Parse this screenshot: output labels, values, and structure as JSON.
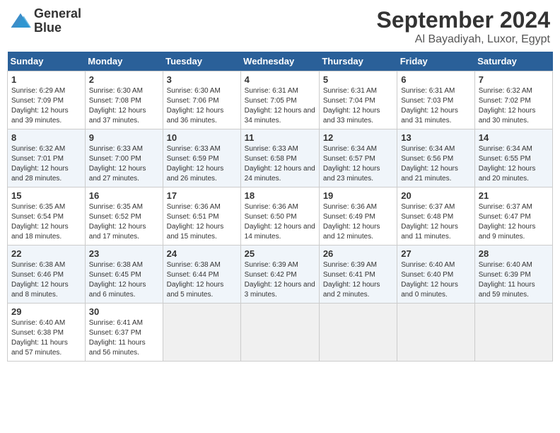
{
  "header": {
    "logo_line1": "General",
    "logo_line2": "Blue",
    "month": "September 2024",
    "location": "Al Bayadiyah, Luxor, Egypt"
  },
  "days_of_week": [
    "Sunday",
    "Monday",
    "Tuesday",
    "Wednesday",
    "Thursday",
    "Friday",
    "Saturday"
  ],
  "weeks": [
    [
      {
        "day": "1",
        "sunrise": "6:29 AM",
        "sunset": "7:09 PM",
        "daylight": "12 hours and 39 minutes."
      },
      {
        "day": "2",
        "sunrise": "6:30 AM",
        "sunset": "7:08 PM",
        "daylight": "12 hours and 37 minutes."
      },
      {
        "day": "3",
        "sunrise": "6:30 AM",
        "sunset": "7:06 PM",
        "daylight": "12 hours and 36 minutes."
      },
      {
        "day": "4",
        "sunrise": "6:31 AM",
        "sunset": "7:05 PM",
        "daylight": "12 hours and 34 minutes."
      },
      {
        "day": "5",
        "sunrise": "6:31 AM",
        "sunset": "7:04 PM",
        "daylight": "12 hours and 33 minutes."
      },
      {
        "day": "6",
        "sunrise": "6:31 AM",
        "sunset": "7:03 PM",
        "daylight": "12 hours and 31 minutes."
      },
      {
        "day": "7",
        "sunrise": "6:32 AM",
        "sunset": "7:02 PM",
        "daylight": "12 hours and 30 minutes."
      }
    ],
    [
      {
        "day": "8",
        "sunrise": "6:32 AM",
        "sunset": "7:01 PM",
        "daylight": "12 hours and 28 minutes."
      },
      {
        "day": "9",
        "sunrise": "6:33 AM",
        "sunset": "7:00 PM",
        "daylight": "12 hours and 27 minutes."
      },
      {
        "day": "10",
        "sunrise": "6:33 AM",
        "sunset": "6:59 PM",
        "daylight": "12 hours and 26 minutes."
      },
      {
        "day": "11",
        "sunrise": "6:33 AM",
        "sunset": "6:58 PM",
        "daylight": "12 hours and 24 minutes."
      },
      {
        "day": "12",
        "sunrise": "6:34 AM",
        "sunset": "6:57 PM",
        "daylight": "12 hours and 23 minutes."
      },
      {
        "day": "13",
        "sunrise": "6:34 AM",
        "sunset": "6:56 PM",
        "daylight": "12 hours and 21 minutes."
      },
      {
        "day": "14",
        "sunrise": "6:34 AM",
        "sunset": "6:55 PM",
        "daylight": "12 hours and 20 minutes."
      }
    ],
    [
      {
        "day": "15",
        "sunrise": "6:35 AM",
        "sunset": "6:54 PM",
        "daylight": "12 hours and 18 minutes."
      },
      {
        "day": "16",
        "sunrise": "6:35 AM",
        "sunset": "6:52 PM",
        "daylight": "12 hours and 17 minutes."
      },
      {
        "day": "17",
        "sunrise": "6:36 AM",
        "sunset": "6:51 PM",
        "daylight": "12 hours and 15 minutes."
      },
      {
        "day": "18",
        "sunrise": "6:36 AM",
        "sunset": "6:50 PM",
        "daylight": "12 hours and 14 minutes."
      },
      {
        "day": "19",
        "sunrise": "6:36 AM",
        "sunset": "6:49 PM",
        "daylight": "12 hours and 12 minutes."
      },
      {
        "day": "20",
        "sunrise": "6:37 AM",
        "sunset": "6:48 PM",
        "daylight": "12 hours and 11 minutes."
      },
      {
        "day": "21",
        "sunrise": "6:37 AM",
        "sunset": "6:47 PM",
        "daylight": "12 hours and 9 minutes."
      }
    ],
    [
      {
        "day": "22",
        "sunrise": "6:38 AM",
        "sunset": "6:46 PM",
        "daylight": "12 hours and 8 minutes."
      },
      {
        "day": "23",
        "sunrise": "6:38 AM",
        "sunset": "6:45 PM",
        "daylight": "12 hours and 6 minutes."
      },
      {
        "day": "24",
        "sunrise": "6:38 AM",
        "sunset": "6:44 PM",
        "daylight": "12 hours and 5 minutes."
      },
      {
        "day": "25",
        "sunrise": "6:39 AM",
        "sunset": "6:42 PM",
        "daylight": "12 hours and 3 minutes."
      },
      {
        "day": "26",
        "sunrise": "6:39 AM",
        "sunset": "6:41 PM",
        "daylight": "12 hours and 2 minutes."
      },
      {
        "day": "27",
        "sunrise": "6:40 AM",
        "sunset": "6:40 PM",
        "daylight": "12 hours and 0 minutes."
      },
      {
        "day": "28",
        "sunrise": "6:40 AM",
        "sunset": "6:39 PM",
        "daylight": "11 hours and 59 minutes."
      }
    ],
    [
      {
        "day": "29",
        "sunrise": "6:40 AM",
        "sunset": "6:38 PM",
        "daylight": "11 hours and 57 minutes."
      },
      {
        "day": "30",
        "sunrise": "6:41 AM",
        "sunset": "6:37 PM",
        "daylight": "11 hours and 56 minutes."
      },
      null,
      null,
      null,
      null,
      null
    ]
  ]
}
